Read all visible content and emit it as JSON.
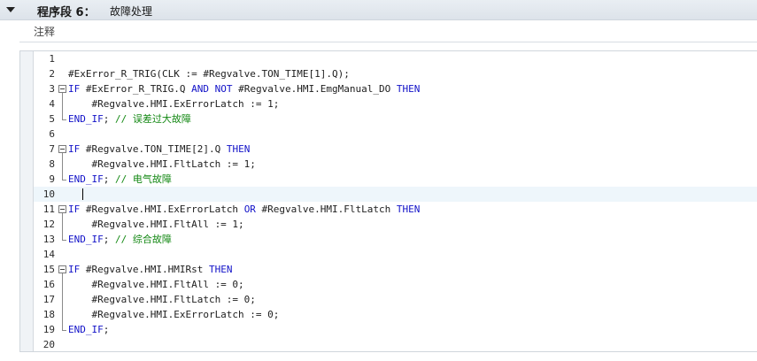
{
  "network": {
    "label": "程序段 6：",
    "title": "故障处理"
  },
  "comment": {
    "label": "注释"
  },
  "code": {
    "lines": [
      {
        "num": "1",
        "segments": []
      },
      {
        "num": "2",
        "segments": [
          {
            "t": "#ExError_R_TRIG(CLK := #Regvalve.TON_TIME[1].Q);",
            "k": "plain"
          }
        ]
      },
      {
        "num": "3",
        "segments": [
          {
            "t": "IF",
            "k": "kw"
          },
          {
            "t": " #ExError_R_TRIG.Q ",
            "k": "plain"
          },
          {
            "t": "AND NOT",
            "k": "kw"
          },
          {
            "t": " #Regvalve.HMI.EmgManual_DO ",
            "k": "plain"
          },
          {
            "t": "THEN",
            "k": "kw"
          }
        ]
      },
      {
        "num": "4",
        "segments": [
          {
            "t": "    #Regvalve.HMI.ExErrorLatch := 1;",
            "k": "plain"
          }
        ]
      },
      {
        "num": "5",
        "segments": [
          {
            "t": "END_IF",
            "k": "kw"
          },
          {
            "t": "; ",
            "k": "plain"
          },
          {
            "t": "// 误差过大故障",
            "k": "cm"
          }
        ]
      },
      {
        "num": "6",
        "segments": []
      },
      {
        "num": "7",
        "segments": [
          {
            "t": "IF",
            "k": "kw"
          },
          {
            "t": " #Regvalve.TON_TIME[2].Q ",
            "k": "plain"
          },
          {
            "t": "THEN",
            "k": "kw"
          }
        ]
      },
      {
        "num": "8",
        "segments": [
          {
            "t": "    #Regvalve.HMI.FltLatch := 1;",
            "k": "plain"
          }
        ]
      },
      {
        "num": "9",
        "segments": [
          {
            "t": "END_IF",
            "k": "kw"
          },
          {
            "t": "; ",
            "k": "plain"
          },
          {
            "t": "// 电气故障",
            "k": "cm"
          }
        ]
      },
      {
        "num": "10",
        "segments": []
      },
      {
        "num": "11",
        "segments": [
          {
            "t": "IF",
            "k": "kw"
          },
          {
            "t": " #Regvalve.HMI.ExErrorLatch ",
            "k": "plain"
          },
          {
            "t": "OR",
            "k": "kw"
          },
          {
            "t": " #Regvalve.HMI.FltLatch ",
            "k": "plain"
          },
          {
            "t": "THEN",
            "k": "kw"
          }
        ]
      },
      {
        "num": "12",
        "segments": [
          {
            "t": "    #Regvalve.HMI.FltAll := 1;",
            "k": "plain"
          }
        ]
      },
      {
        "num": "13",
        "segments": [
          {
            "t": "END_IF",
            "k": "kw"
          },
          {
            "t": "; ",
            "k": "plain"
          },
          {
            "t": "// 综合故障",
            "k": "cm"
          }
        ]
      },
      {
        "num": "14",
        "segments": []
      },
      {
        "num": "15",
        "segments": [
          {
            "t": "IF",
            "k": "kw"
          },
          {
            "t": " #Regvalve.HMI.HMIRst ",
            "k": "plain"
          },
          {
            "t": "THEN",
            "k": "kw"
          }
        ]
      },
      {
        "num": "16",
        "segments": [
          {
            "t": "    #Regvalve.HMI.FltAll := 0;",
            "k": "plain"
          }
        ]
      },
      {
        "num": "17",
        "segments": [
          {
            "t": "    #Regvalve.HMI.FltLatch := 0;",
            "k": "plain"
          }
        ]
      },
      {
        "num": "18",
        "segments": [
          {
            "t": "    #Regvalve.HMI.ExErrorLatch := 0;",
            "k": "plain"
          }
        ]
      },
      {
        "num": "19",
        "segments": [
          {
            "t": "END_IF",
            "k": "kw"
          },
          {
            "t": ";",
            "k": "plain"
          }
        ]
      },
      {
        "num": "20",
        "segments": []
      }
    ],
    "current_line": "10",
    "colors": {
      "keyword": "#1212c8",
      "comment": "#138813",
      "text": "#1d1d1d"
    }
  }
}
